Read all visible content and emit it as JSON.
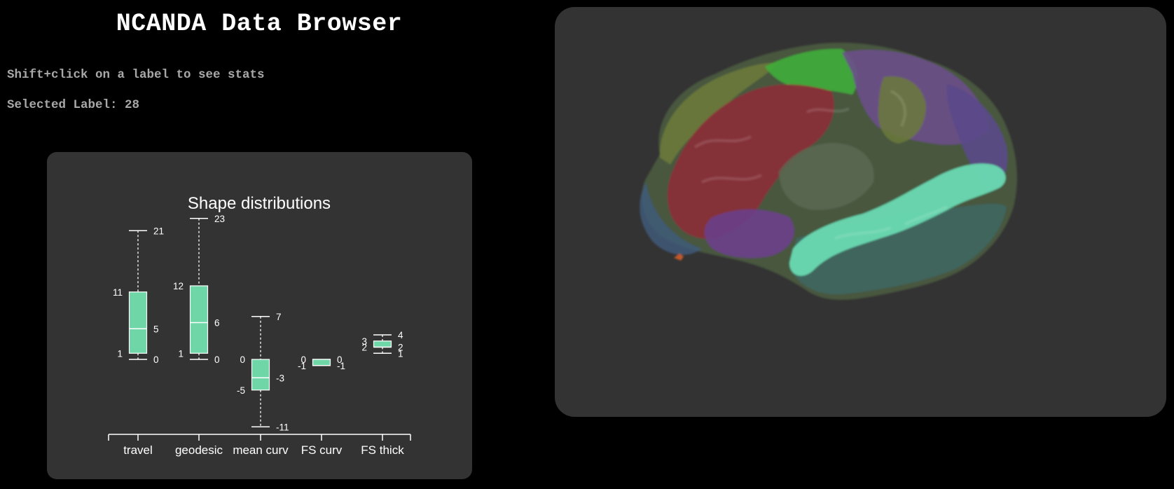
{
  "header": {
    "title": "NCANDA Data Browser",
    "instruction": "Shift+click on a label to see stats",
    "selected_label": "Selected Label: 28"
  },
  "colors": {
    "background": "#000000",
    "panel": "#333333",
    "box_fill": "#6fd6a8",
    "text": "#ffffff",
    "muted_text": "#a8a8a8"
  },
  "chart_data": {
    "type": "boxplot",
    "title": "Shape distributions",
    "categories": [
      "travel",
      "geodesic",
      "mean curv",
      "FS curv",
      "FS thick"
    ],
    "boxes": [
      {
        "category": "travel",
        "whisker_low": 0,
        "q1": 1,
        "median": 5,
        "q3": 11,
        "whisker_high": 21
      },
      {
        "category": "geodesic",
        "whisker_low": 0,
        "q1": 1,
        "median": 6,
        "q3": 12,
        "whisker_high": 23
      },
      {
        "category": "mean curv",
        "whisker_low": -11,
        "q1": -5,
        "median": -3,
        "q3": 0,
        "whisker_high": 7
      },
      {
        "category": "FS curv",
        "whisker_low": -1,
        "q1": -1,
        "median": -1,
        "q3": 0,
        "whisker_high": 0
      },
      {
        "category": "FS thick",
        "whisker_low": 1,
        "q1": 2,
        "median": 2,
        "q3": 3,
        "whisker_high": 4
      }
    ],
    "labels": [
      {
        "text": "21",
        "value": 21,
        "cat": 0,
        "side": "right"
      },
      {
        "text": "11",
        "value": 11,
        "cat": 0,
        "side": "left"
      },
      {
        "text": "5",
        "value": 5,
        "cat": 0,
        "side": "right"
      },
      {
        "text": "1",
        "value": 1,
        "cat": 0,
        "side": "left"
      },
      {
        "text": "0",
        "value": 0,
        "cat": 0,
        "side": "right"
      },
      {
        "text": "23",
        "value": 23,
        "cat": 1,
        "side": "right"
      },
      {
        "text": "12",
        "value": 12,
        "cat": 1,
        "side": "left"
      },
      {
        "text": "6",
        "value": 6,
        "cat": 1,
        "side": "right"
      },
      {
        "text": "1",
        "value": 1,
        "cat": 1,
        "side": "left"
      },
      {
        "text": "0",
        "value": 0,
        "cat": 1,
        "side": "right"
      },
      {
        "text": "7",
        "value": 7,
        "cat": 2,
        "side": "right"
      },
      {
        "text": "0",
        "value": 0,
        "cat": 2,
        "side": "left"
      },
      {
        "text": "-3",
        "value": -3,
        "cat": 2,
        "side": "right"
      },
      {
        "text": "-5",
        "value": -5,
        "cat": 2,
        "side": "left"
      },
      {
        "text": "-11",
        "value": -11,
        "cat": 2,
        "side": "right"
      },
      {
        "text": "0",
        "value": 0,
        "cat": 3,
        "side": "left"
      },
      {
        "text": "0",
        "value": 0,
        "cat": 3,
        "side": "right"
      },
      {
        "text": "-1",
        "value": -1,
        "cat": 3,
        "side": "left"
      },
      {
        "text": "-1",
        "value": -1,
        "cat": 3,
        "side": "right"
      },
      {
        "text": "3",
        "value": 3,
        "cat": 4,
        "side": "left"
      },
      {
        "text": "2",
        "value": 2,
        "cat": 4,
        "side": "left"
      },
      {
        "text": "4",
        "value": 4,
        "cat": 4,
        "side": "right"
      },
      {
        "text": "2",
        "value": 2,
        "cat": 4,
        "side": "right"
      },
      {
        "text": "1",
        "value": 1,
        "cat": 4,
        "side": "right"
      }
    ],
    "ylim": [
      -11,
      23
    ],
    "grid": false
  }
}
